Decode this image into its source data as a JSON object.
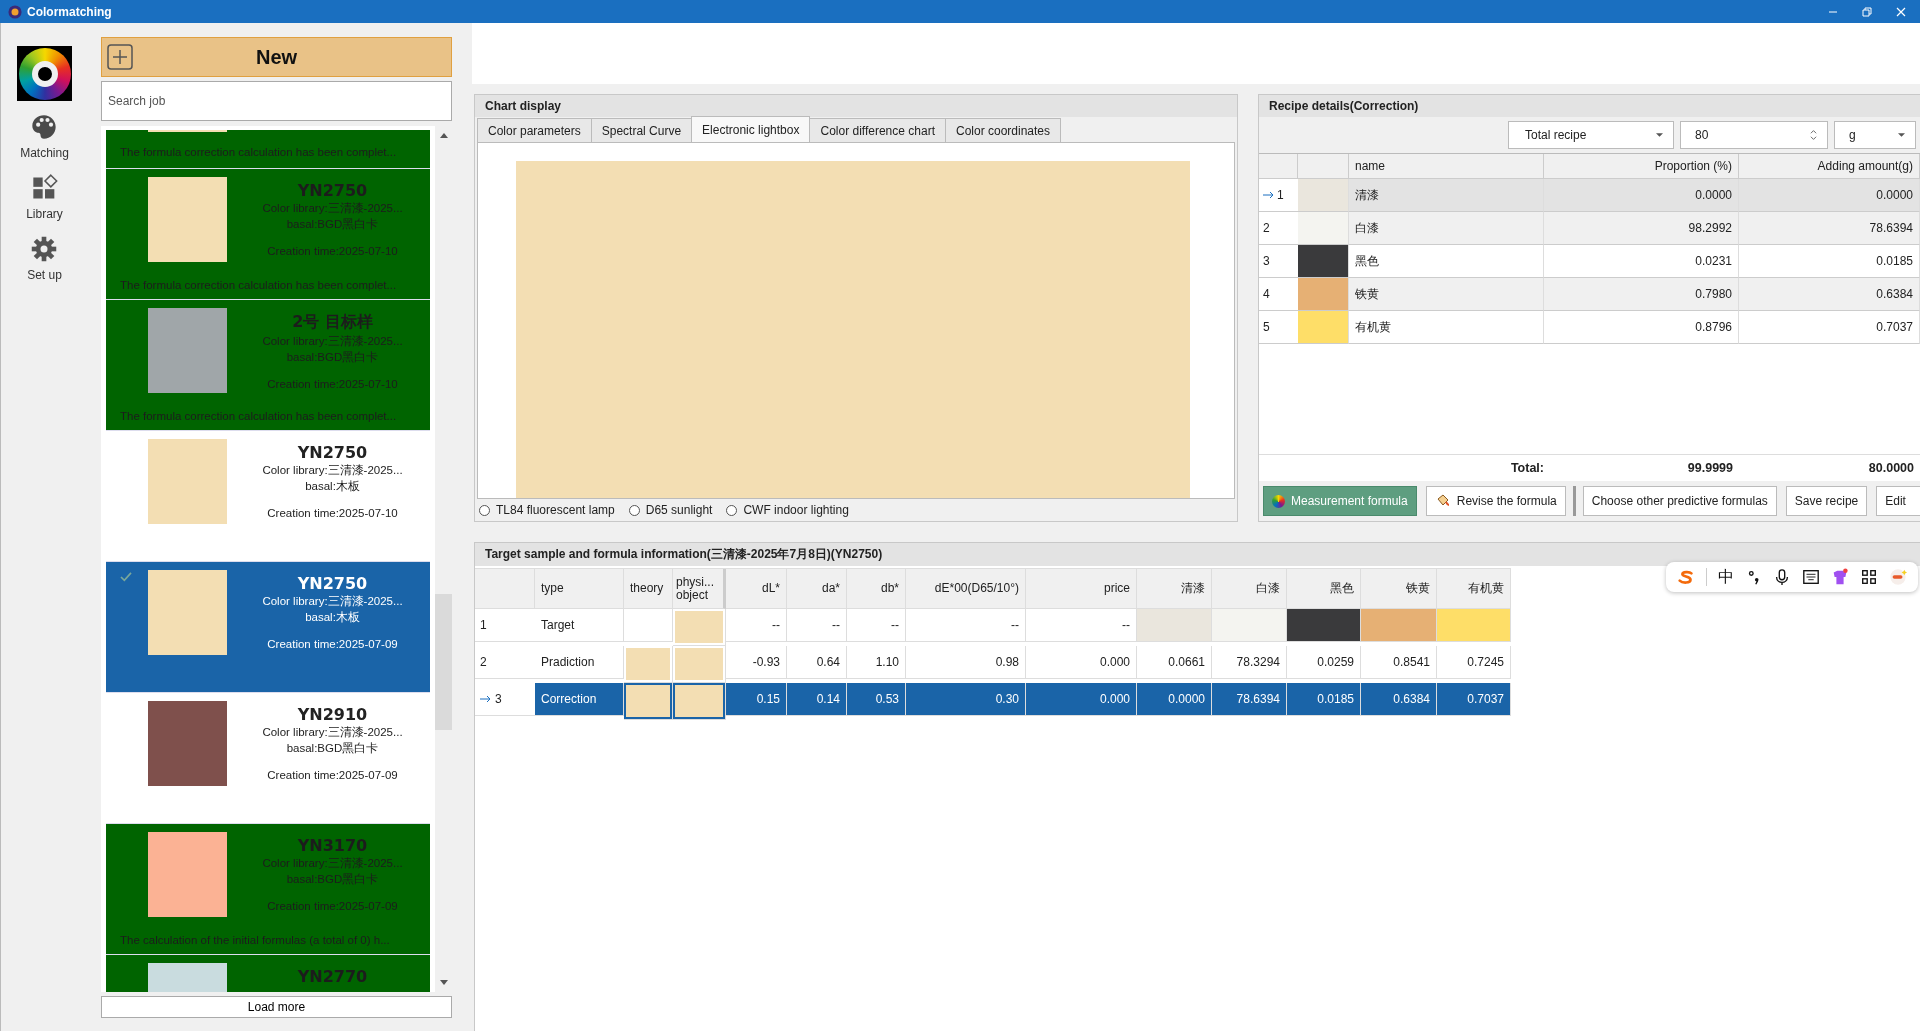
{
  "window": {
    "title": "Colormatching"
  },
  "nav": [
    {
      "label": "Matching"
    },
    {
      "label": "Library"
    },
    {
      "label": "Set up"
    }
  ],
  "new_button": "New",
  "search": {
    "placeholder": "Search job"
  },
  "jobs": [
    {
      "calculated": true,
      "selected": false,
      "color": "#f3deb3",
      "message": "The formula correction calculation has been complet..."
    },
    {
      "calculated": true,
      "selected": false,
      "color": "#f3deb3",
      "title": "YN2750",
      "library": "Color library:三清漆-2025...",
      "basal": "basal:BGD黑白卡",
      "created": "Creation time:2025-07-10",
      "message": "The formula correction calculation has been complet..."
    },
    {
      "calculated": true,
      "selected": false,
      "color": "#a0a6a9",
      "title": "2号 目标样",
      "library": "Color library:三清漆-2025...",
      "basal": "basal:BGD黑白卡",
      "created": "Creation time:2025-07-10",
      "message": "The formula correction calculation has been complet..."
    },
    {
      "calculated": false,
      "selected": false,
      "color": "#f3deb3",
      "title": "YN2750",
      "library": "Color library:三清漆-2025...",
      "basal": "basal:木板",
      "created": "Creation time:2025-07-10"
    },
    {
      "calculated": false,
      "selected": true,
      "color": "#f3deb3",
      "title": "YN2750",
      "library": "Color library:三清漆-2025...",
      "basal": "basal:木板",
      "created": "Creation time:2025-07-09"
    },
    {
      "calculated": false,
      "selected": false,
      "color": "#7f504c",
      "title": "YN2910",
      "library": "Color library:三清漆-2025...",
      "basal": "basal:BGD黑白卡",
      "created": "Creation time:2025-07-09"
    },
    {
      "calculated": true,
      "selected": false,
      "color": "#fbb294",
      "title": "YN3170",
      "library": "Color library:三清漆-2025...",
      "basal": "basal:BGD黑白卡",
      "created": "Creation time:2025-07-09",
      "message": "The calculation of the initial formulas (a total of 0) h..."
    },
    {
      "calculated": true,
      "selected": false,
      "color": "#c9dcdf",
      "title": "YN2770"
    }
  ],
  "load_more": "Load more",
  "chart_panel": {
    "title": "Chart display",
    "tabs": [
      {
        "label": "Color parameters",
        "selected": false
      },
      {
        "label": "Spectral Curve",
        "selected": false
      },
      {
        "label": "Electronic lightbox",
        "selected": true
      },
      {
        "label": "Color difference chart",
        "selected": false
      },
      {
        "label": "Color coordinates",
        "selected": false
      }
    ],
    "lightbox": {
      "color": "#f3deb3"
    },
    "lights": [
      {
        "label": "TL84 fluorescent lamp",
        "selected": false
      },
      {
        "label": "D65 sunlight",
        "selected": false
      },
      {
        "label": "CWF indoor lighting",
        "selected": false
      }
    ]
  },
  "recipe": {
    "title": "Recipe details(Correction)",
    "mode": "Total recipe",
    "amount": "80",
    "unit": "g",
    "columns": [
      "name",
      "Proportion (%)",
      "Adding amount(g)"
    ],
    "rows": [
      {
        "index": "1",
        "current": true,
        "color": "#eae6dd",
        "name": "清漆",
        "proportion": "0.0000",
        "amount": "0.0000"
      },
      {
        "index": "2",
        "current": false,
        "color": "#f4f4f0",
        "name": "白漆",
        "proportion": "98.2992",
        "amount": "78.6394"
      },
      {
        "index": "3",
        "current": false,
        "color": "#3a3a3c",
        "name": "黑色",
        "proportion": "0.0231",
        "amount": "0.0185"
      },
      {
        "index": "4",
        "current": false,
        "color": "#e6b074",
        "name": "铁黄",
        "proportion": "0.7980",
        "amount": "0.6384"
      },
      {
        "index": "5",
        "current": false,
        "color": "#fede68",
        "name": "有机黄",
        "proportion": "0.8796",
        "amount": "0.7037"
      }
    ],
    "total_label": "Total:",
    "total_proportion": "99.9999",
    "total_amount": "80.0000",
    "buttons": [
      {
        "label": "Measurement formula",
        "kind": "primary"
      },
      {
        "label": "Revise the formula",
        "kind": "brush"
      },
      {
        "label": "Choose other predictive formulas",
        "kind": "plain"
      },
      {
        "label": "Save recipe",
        "kind": "plain"
      },
      {
        "label": "Edit",
        "kind": "plain"
      }
    ]
  },
  "target": {
    "title": "Target sample and formula information(三清漆-2025年7月8日)(YN2750)",
    "columns": [
      "type",
      "theory",
      "physi... object",
      "dL*",
      "da*",
      "db*",
      "dE*00(D65/10°)",
      "price",
      "清漆",
      "白漆",
      "黑色",
      "铁黄",
      "有机黄"
    ],
    "rows": [
      {
        "index": "1",
        "type": "Target",
        "selected": false,
        "physical": {
          "color": "#f3deb3"
        },
        "values": [
          "--",
          "--",
          "--",
          "--",
          "--"
        ],
        "colorants": [
          {
            "color": "#eae6dd"
          },
          {
            "color": "#f4f4f0"
          },
          {
            "color": "#3a3a3c"
          },
          {
            "color": "#e6b074"
          },
          {
            "color": "#fede68"
          }
        ]
      },
      {
        "index": "2",
        "type": "Pradiction",
        "selected": false,
        "theory": {
          "color": "#f3deb3"
        },
        "physical": {
          "color": "#f3deb3"
        },
        "values": [
          "-0.93",
          "0.64",
          "1.10",
          "0.98",
          "0.000"
        ],
        "amounts": [
          "0.0661",
          "78.3294",
          "0.0259",
          "0.8541",
          "0.7245"
        ]
      },
      {
        "index": "3",
        "type": "Correction",
        "selected": true,
        "theory": {
          "color": "#f3deb3"
        },
        "physical": {
          "color": "#f3deb3"
        },
        "values": [
          "0.15",
          "0.14",
          "0.53",
          "0.30",
          "0.000"
        ],
        "amounts": [
          "0.0000",
          "78.6394",
          "0.0185",
          "0.6384",
          "0.7037"
        ]
      }
    ]
  },
  "ime_toolbar": {
    "mode": "中"
  }
}
